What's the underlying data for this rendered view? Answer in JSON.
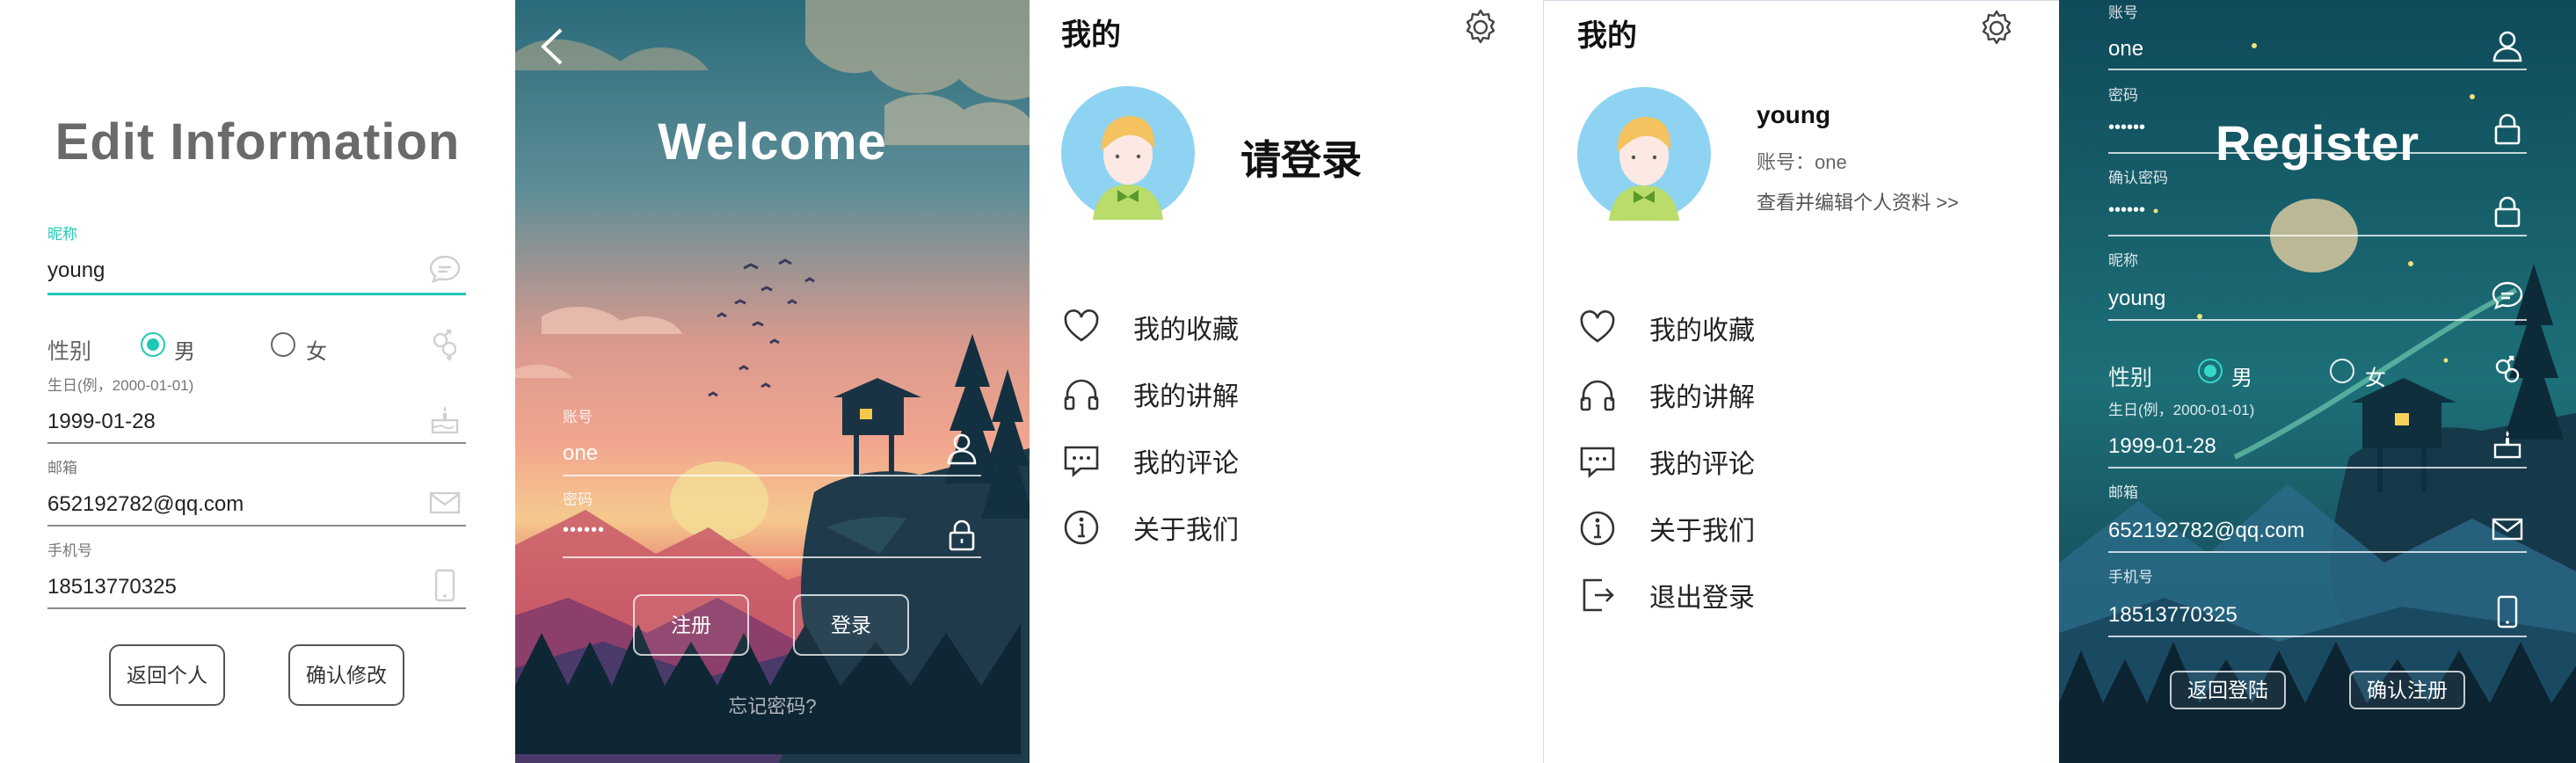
{
  "edit": {
    "title": "Edit Information",
    "nickname_label": "昵称",
    "nickname_value": "young",
    "gender_label": "性别",
    "gender_male": "男",
    "gender_female": "女",
    "birthday_label": "生日(例，2000-01-01)",
    "birthday_value": "1999-01-28",
    "email_label": "邮箱",
    "email_value": "652192782@qq.com",
    "phone_label": "手机号",
    "phone_value": "18513770325",
    "back_button": "返回个人",
    "confirm_button": "确认修改",
    "accent_color": "#1fc8b4"
  },
  "login": {
    "title": "Welcome",
    "account_label": "账号",
    "account_value": "one",
    "password_label": "密码",
    "password_value": "••••••",
    "register_button": "注册",
    "login_button": "登录",
    "forgot_link": "忘记密码?"
  },
  "profile_guest": {
    "header": "我的",
    "login_prompt": "请登录",
    "menu": [
      "我的收藏",
      "我的讲解",
      "我的评论",
      "关于我们"
    ]
  },
  "profile_user": {
    "header": "我的",
    "username": "young",
    "account_text": "账号：one",
    "edit_link": "查看并编辑个人资料 >>",
    "menu": [
      "我的收藏",
      "我的讲解",
      "我的评论",
      "关于我们",
      "退出登录"
    ]
  },
  "register": {
    "title": "Register",
    "account_label": "账号",
    "account_value": "one",
    "password_label": "密码",
    "password_value": "••••••",
    "confirm_password_label": "确认密码",
    "confirm_password_value": "••••••",
    "nickname_label": "昵称",
    "nickname_value": "young",
    "gender_label": "性别",
    "gender_male": "男",
    "gender_female": "女",
    "birthday_label": "生日(例，2000-01-01)",
    "birthday_value": "1999-01-28",
    "email_label": "邮箱",
    "email_value": "652192782@qq.com",
    "phone_label": "手机号",
    "phone_value": "18513770325",
    "back_button": "返回登陆",
    "confirm_button": "确认注册"
  },
  "icons": {
    "chat": "chat-bubble-icon",
    "gender": "gender-icon",
    "cake": "cake-icon",
    "mail": "mail-icon",
    "phone": "phone-icon",
    "user": "user-icon",
    "lock": "lock-icon",
    "settings": "gear-icon",
    "heart": "heart-icon",
    "headphones": "headphones-icon",
    "comment": "comment-icon",
    "info": "info-icon",
    "logout": "logout-icon"
  }
}
